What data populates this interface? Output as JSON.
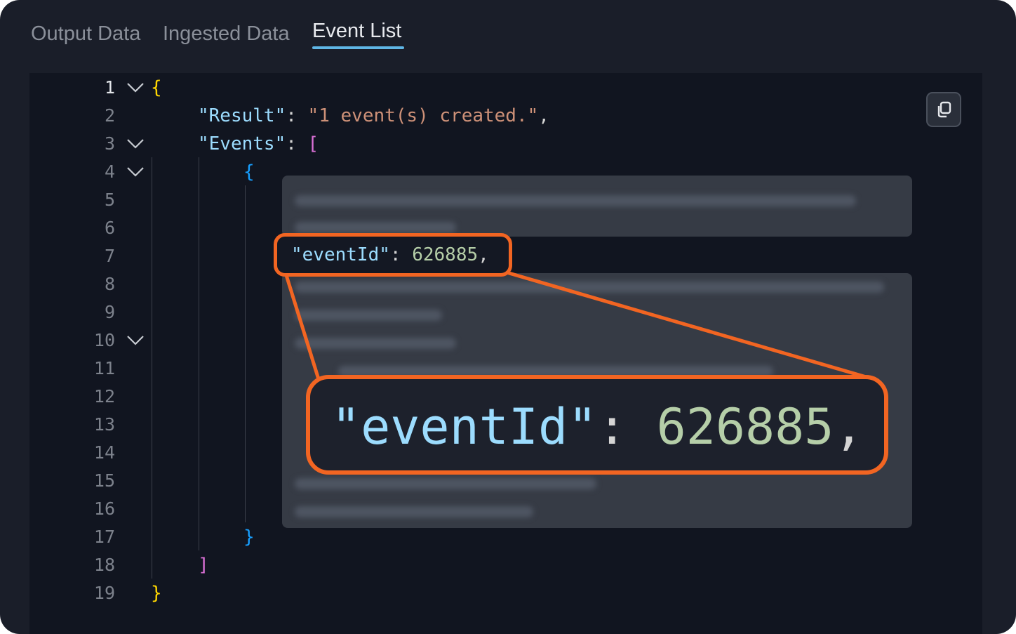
{
  "tabs": [
    {
      "label": "Output Data",
      "active": false
    },
    {
      "label": "Ingested Data",
      "active": false
    },
    {
      "label": "Event List",
      "active": true
    }
  ],
  "line_numbers": [
    "1",
    "2",
    "3",
    "4",
    "5",
    "6",
    "7",
    "8",
    "9",
    "10",
    "11",
    "12",
    "13",
    "14",
    "15",
    "16",
    "17",
    "18",
    "19"
  ],
  "code": {
    "open_brace": "{",
    "result_key": "\"Result\"",
    "result_value": "\"1 event(s) created.\"",
    "events_key": "\"Events\"",
    "open_bracket": "[",
    "event_open": "{",
    "event_close": "}",
    "close_bracket": "]",
    "close_brace": "}",
    "colon": ": ",
    "comma": ","
  },
  "highlight": {
    "key": "\"eventId\"",
    "colon": ": ",
    "value": "626885",
    "comma": ","
  },
  "colors": {
    "highlight_border": "#f26522",
    "tab_underline": "#5fb6e6",
    "background": "#111520"
  },
  "icons": {
    "copy": "copy-icon",
    "fold": "chevron-down-icon"
  }
}
